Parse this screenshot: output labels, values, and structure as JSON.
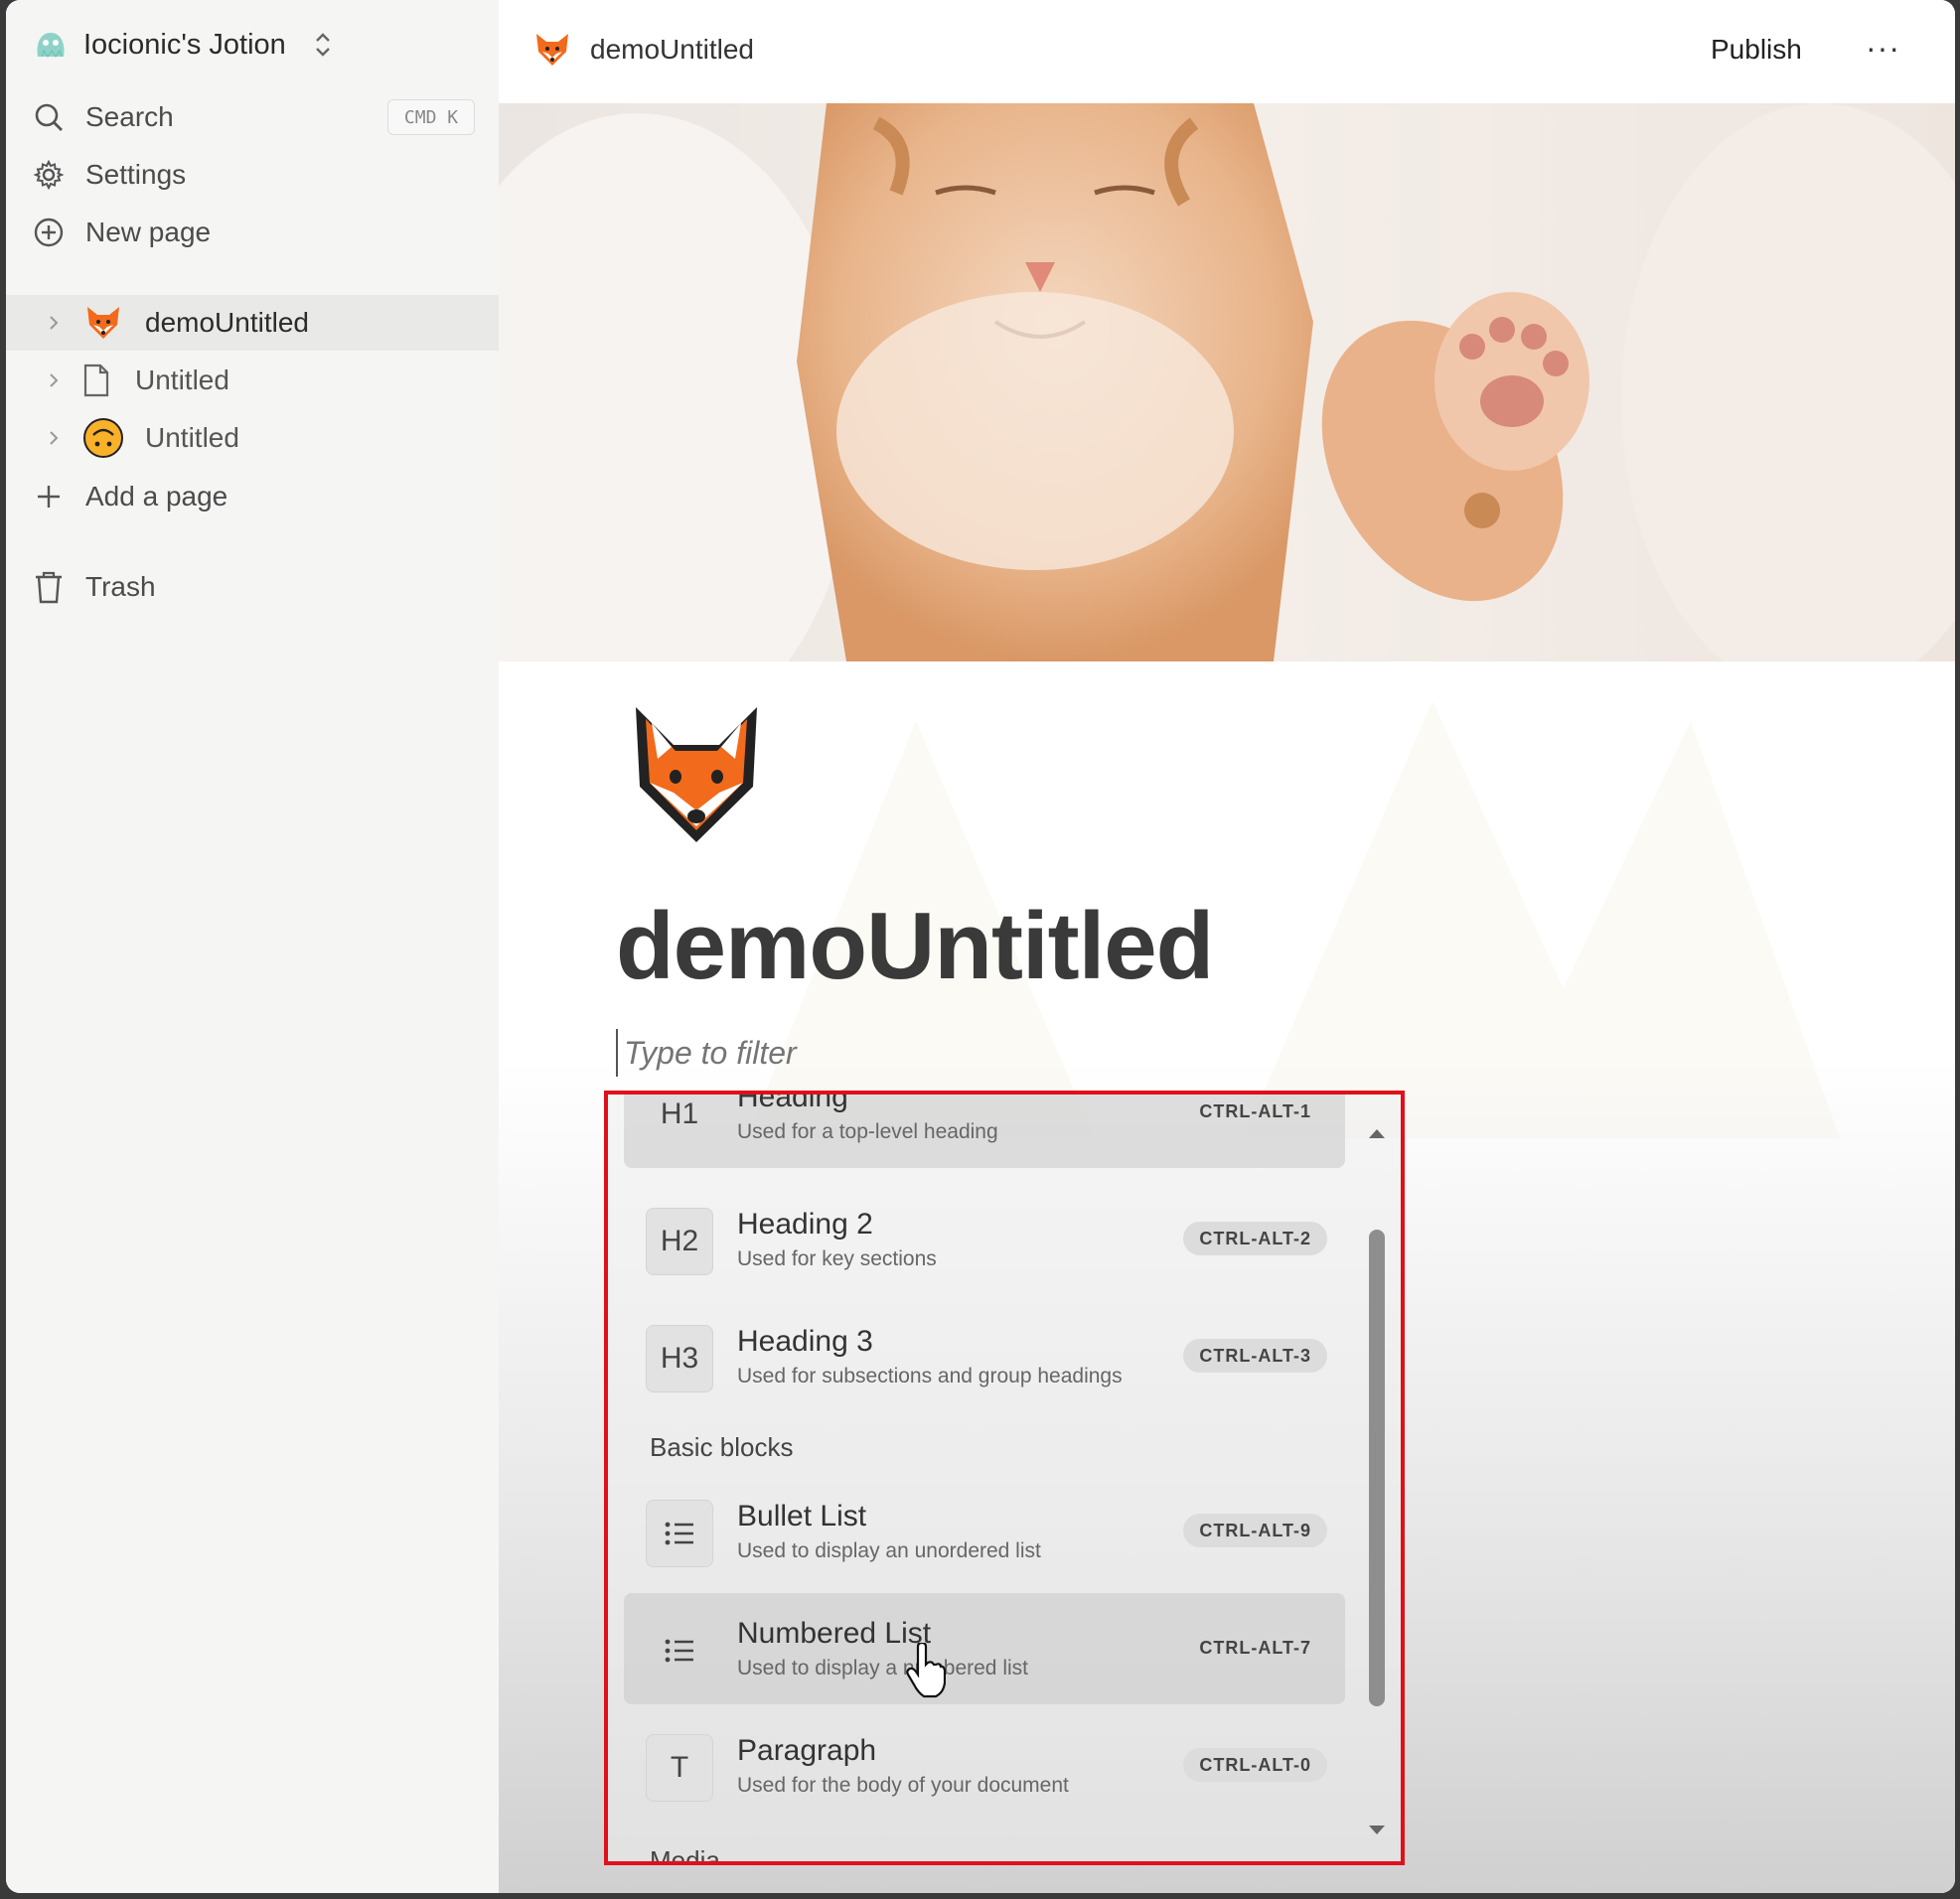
{
  "workspace": {
    "name": "Iocionic's Jotion"
  },
  "sidebar": {
    "search": {
      "label": "Search",
      "shortcut": "CMD K"
    },
    "settings": {
      "label": "Settings"
    },
    "new_page": {
      "label": "New page"
    },
    "pages": [
      {
        "label": "demoUntitled",
        "icon": "fox-emoji-icon",
        "active": true
      },
      {
        "label": "Untitled",
        "icon": "document-icon",
        "active": false
      },
      {
        "label": "Untitled",
        "icon": "upside-down-face-emoji-icon",
        "active": false
      }
    ],
    "add_page": {
      "label": "Add a page"
    },
    "trash": {
      "label": "Trash"
    }
  },
  "topbar": {
    "title": "demoUntitled",
    "publish_label": "Publish",
    "more_label": "···"
  },
  "document": {
    "title": "demoUntitled",
    "filter_placeholder": "Type to filter"
  },
  "slash_menu": {
    "items": [
      {
        "icon_text": "H1",
        "title": "Heading",
        "description": "Used for a top-level heading",
        "shortcut": "CTRL-ALT-1",
        "highlighted": true
      },
      {
        "icon_text": "H2",
        "title": "Heading 2",
        "description": "Used for key sections",
        "shortcut": "CTRL-ALT-2",
        "highlighted": false
      },
      {
        "icon_text": "H3",
        "title": "Heading 3",
        "description": "Used for subsections and group headings",
        "shortcut": "CTRL-ALT-3",
        "highlighted": false
      }
    ],
    "section_basic": "Basic blocks",
    "basic_items": [
      {
        "icon": "bullet-list-icon",
        "title": "Bullet List",
        "description": "Used to display an unordered list",
        "shortcut": "CTRL-ALT-9",
        "highlighted": false
      },
      {
        "icon": "numbered-list-icon",
        "title": "Numbered List",
        "description": "Used to display a numbered list",
        "shortcut": "CTRL-ALT-7",
        "highlighted": true
      },
      {
        "icon_text": "T",
        "title": "Paragraph",
        "description": "Used for the body of your document",
        "shortcut": "CTRL-ALT-0",
        "highlighted": false
      }
    ],
    "section_media": "Media"
  },
  "colors": {
    "highlight_border": "#e0101a",
    "sidebar_bg": "#f5f5f4",
    "fox_orange": "#f26a1b"
  }
}
